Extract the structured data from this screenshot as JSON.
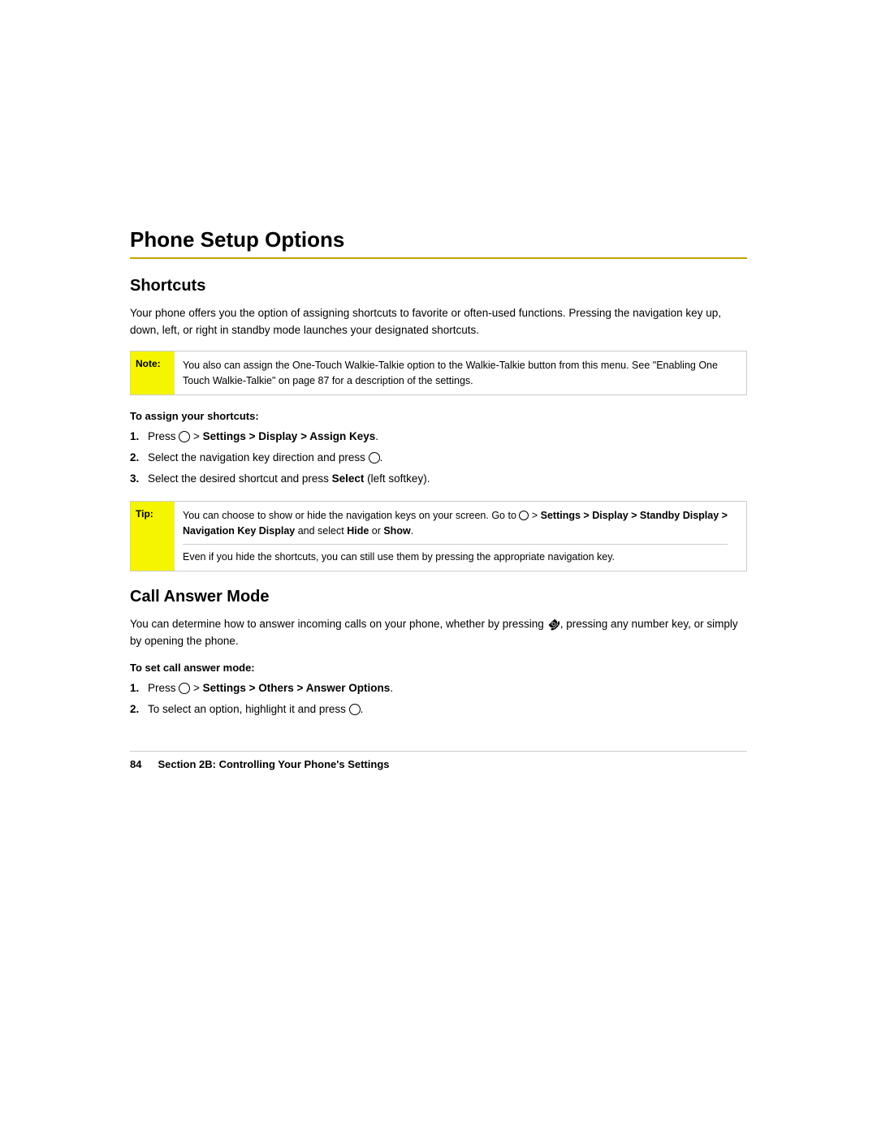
{
  "page": {
    "title": "Phone Setup Options",
    "title_underline": true
  },
  "shortcuts": {
    "heading": "Shortcuts",
    "body": "Your phone offers you the option of assigning shortcuts to favorite or often-used functions. Pressing the navigation key up, down, left, or right in standby mode launches your designated shortcuts.",
    "note": {
      "label": "Note:",
      "text": "You also can assign the One-Touch Walkie-Talkie option to the Walkie-Talkie button from this menu. See \"Enabling One Touch Walkie-Talkie\" on page 87 for a description of the settings."
    },
    "instruction_label": "To assign your shortcuts:",
    "steps": [
      {
        "num": "1.",
        "text_parts": [
          {
            "type": "text",
            "content": "Press "
          },
          {
            "type": "icon",
            "content": "nav-icon"
          },
          {
            "type": "text",
            "content": " > "
          },
          {
            "type": "bold",
            "content": "Settings > Display > Assign Keys"
          },
          {
            "type": "text",
            "content": "."
          }
        ],
        "plain": "Press [icon] > Settings > Display > Assign Keys."
      },
      {
        "num": "2.",
        "text_parts": [
          {
            "type": "text",
            "content": "Select the navigation key direction and press "
          },
          {
            "type": "icon",
            "content": "nav-icon"
          },
          {
            "type": "text",
            "content": "."
          }
        ],
        "plain": "Select the navigation key direction and press [icon]."
      },
      {
        "num": "3.",
        "text_parts": [
          {
            "type": "text",
            "content": "Select the desired shortcut and press "
          },
          {
            "type": "bold",
            "content": "Select"
          },
          {
            "type": "text",
            "content": " (left softkey)."
          }
        ],
        "plain": "Select the desired shortcut and press Select (left softkey)."
      }
    ],
    "tip": {
      "label": "Tip:",
      "line1_parts": "You can choose to show or hide the navigation keys on your screen. Go to [icon] > Settings > Display > Standby Display > Navigation Key Display and select Hide or Show.",
      "line1_bold": [
        "Settings > Display > Standby Display >",
        "Navigation Key Display",
        "Hide",
        "Show"
      ],
      "line2": "Even if you hide the shortcuts, you can still use them by pressing the appropriate navigation key."
    }
  },
  "call_answer_mode": {
    "heading": "Call Answer Mode",
    "body": "You can determine how to answer incoming calls on your phone, whether by pressing [phone-icon], pressing any number key, or simply by opening the phone.",
    "instruction_label": "To set call answer mode:",
    "steps": [
      {
        "num": "1.",
        "text_parts": [
          {
            "type": "text",
            "content": "Press "
          },
          {
            "type": "icon",
            "content": "nav-icon"
          },
          {
            "type": "text",
            "content": " > "
          },
          {
            "type": "bold",
            "content": "Settings > Others > Answer Options"
          },
          {
            "type": "text",
            "content": "."
          }
        ],
        "plain": "Press [icon] > Settings > Others > Answer Options."
      },
      {
        "num": "2.",
        "text_parts": [
          {
            "type": "text",
            "content": "To select an option, highlight it and press "
          },
          {
            "type": "icon",
            "content": "nav-icon"
          },
          {
            "type": "text",
            "content": "."
          }
        ],
        "plain": "To select an option, highlight it and press [icon]."
      }
    ]
  },
  "footer": {
    "page_number": "84",
    "section_text": "Section 2B: Controlling Your Phone's Settings"
  }
}
